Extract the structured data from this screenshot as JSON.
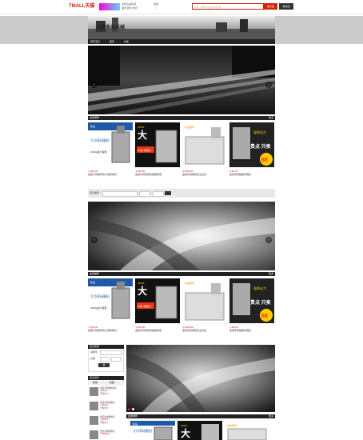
{
  "header": {
    "logo": "TMALL天猫",
    "shop_name": "金辰食品机械",
    "shop_sub": "描述 服务 物流",
    "fav_label": "收藏",
    "search_placeholder": "搜索 天猫 商品/品牌/店铺",
    "search_tmall": "搜天猫",
    "search_shop": "搜本店"
  },
  "banner": {
    "title": "金辰食品机械"
  },
  "nav": {
    "items": [
      "所有宝贝",
      "首页",
      "分类"
    ]
  },
  "sections": [
    {
      "title": "金辰推荐",
      "more": "更多"
    },
    {
      "title": "金辰推荐",
      "more": "更多"
    },
    {
      "title": "金辰推荐",
      "more": "更多"
    }
  ],
  "products": [
    {
      "price": "￥399.00",
      "desc": "金辰不锈钢家用小型粉碎机",
      "badge": "新品",
      "banner": "大功率研磨机",
      "caption": "2000g超大容量"
    },
    {
      "price": "￥968.00",
      "desc": "金辰中药粉碎机超细研磨",
      "badge": "45000",
      "banner": "大",
      "caption": "20倍+研磨力"
    },
    {
      "price": "￥2998.00",
      "desc": "金辰商用磨粉机全自动",
      "badge": "",
      "banner": "商品推荐",
      "caption": ""
    },
    {
      "price": "￥88.00",
      "desc": "金辰家用破壁料理机",
      "badge": "强悍动力",
      "banner": "贵点 只卖",
      "caption": "88"
    }
  ],
  "filter": {
    "label": "宝贝搜索",
    "price_label": "价格",
    "to": "-",
    "go": "搜索"
  },
  "sidebar": {
    "search_title": "宝贝搜索",
    "keyword": "关键字",
    "price": "价格",
    "go": "搜",
    "rank_title": "宝贝排行",
    "tabs": [
      "销量",
      "收藏"
    ],
    "items": [
      {
        "name": "金辰不锈钢粉碎机",
        "price": "￥88.00",
        "sales": "已售出 2"
      },
      {
        "name": "金辰中药研磨机",
        "price": "￥968.00",
        "sales": "已售出 5"
      },
      {
        "name": "金辰商用磨粉机",
        "price": "￥998.00",
        "sales": "已售出 1"
      },
      {
        "name": "金辰家用料理机",
        "price": "￥2998.00",
        "sales": "已售出 3"
      }
    ]
  }
}
